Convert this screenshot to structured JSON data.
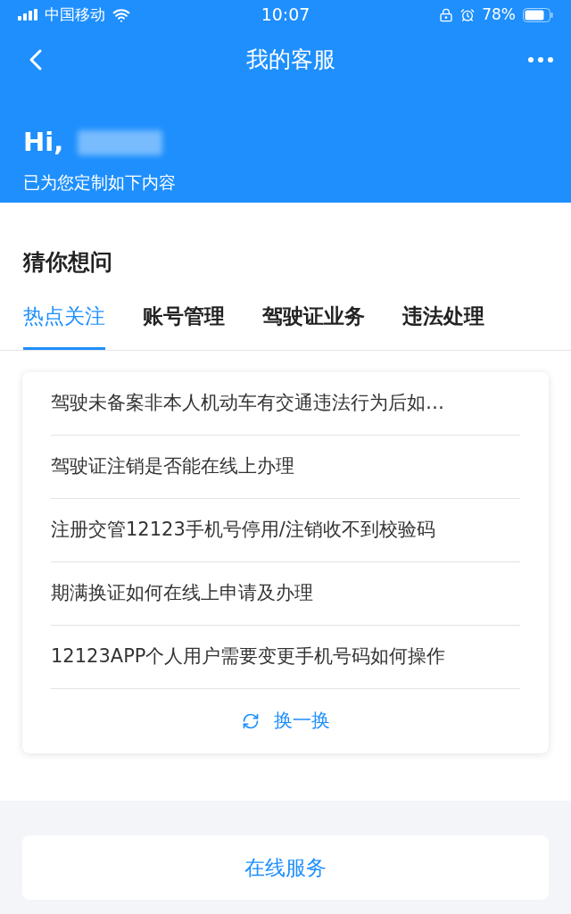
{
  "status_bar": {
    "carrier": "中国移动",
    "time": "10:07",
    "battery": "78%"
  },
  "nav": {
    "title": "我的客服"
  },
  "greeting": {
    "hello": "Hi,",
    "subtitle": "已为您定制如下内容"
  },
  "section_title": "猜你想问",
  "tabs": [
    {
      "label": "热点关注",
      "selected": true
    },
    {
      "label": "账号管理",
      "selected": false
    },
    {
      "label": "驾驶证业务",
      "selected": false
    },
    {
      "label": "违法处理",
      "selected": false
    }
  ],
  "questions": [
    "驾驶未备案非本人机动车有交通违法行为后如…",
    "驾驶证注销是否能在线上办理",
    "注册交管12123手机号停用/注销收不到校验码",
    "期满换证如何在线上申请及办理",
    "12123APP个人用户需要变更手机号码如何操作"
  ],
  "refresh_label": "换一换",
  "online_service": "在线服务"
}
